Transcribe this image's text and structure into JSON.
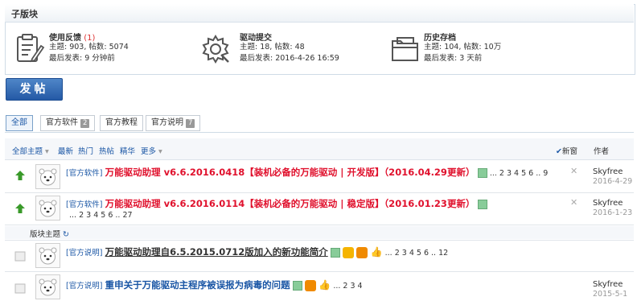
{
  "subforums": {
    "title": "子版块",
    "items": [
      {
        "name": "使用反馈",
        "count": "(1)",
        "stats": "主题: 903, 帖数: 5074",
        "last": "最后发表: 9 分钟前",
        "icon": "clipboard-icon"
      },
      {
        "name": "驱动提交",
        "count": "",
        "stats": "主题: 18, 帖数: 48",
        "last": "最后发表: 2016-4-26 16:59",
        "icon": "gear-icon"
      },
      {
        "name": "历史存档",
        "count": "",
        "stats": "主题: 104, 帖数: 10万",
        "last": "最后发表: 3 天前",
        "icon": "folder-icon"
      }
    ]
  },
  "post_button": "发帖",
  "tabs": [
    {
      "label": "全部",
      "count": ""
    },
    {
      "label": "官方软件",
      "count": "2"
    },
    {
      "label": "官方教程",
      "count": ""
    },
    {
      "label": "官方说明",
      "count": "7"
    }
  ],
  "filter": {
    "all_topics": "全部主题",
    "latest": "最新",
    "hot": "热门",
    "hot_posts": "热帖",
    "digest": "精华",
    "more": "更多",
    "new_window": "新窗",
    "author_col": "作者"
  },
  "section_label": "版块主题",
  "threads": [
    {
      "category": "[官方软件]",
      "title": "万能驱动助理 v6.6.2016.0418【装机必备的万能驱动 | 开发版】（2016.04.29更新）",
      "pages": "... 2 3 4 5 6 .. 9",
      "author": "Skyfree",
      "date": "2016-4-29"
    },
    {
      "category": "[官方软件]",
      "title": "万能驱动助理 v6.6.2016.0114【装机必备的万能驱动 | 稳定版】（2016.01.23更新）",
      "pages": "... 2 3 4 5 6 .. 27",
      "author": "Skyfree",
      "date": "2016-1-23"
    },
    {
      "category": "[官方说明]",
      "title": "万能驱动助理自6.5.2015.0712版加入的新功能简介",
      "pages": "... 2 3 4 5 6 .. 12",
      "author": "",
      "date": ""
    },
    {
      "category": "[官方说明]",
      "title": "重申关于万能驱动主程序被误报为病毒的问题",
      "pages": "... 2 3 4",
      "author": "Skyfree",
      "date": "2015-5-1"
    }
  ],
  "colors": {
    "accent": "#1a56a5",
    "red_title": "#e0112d",
    "button": "#2f67b0"
  }
}
